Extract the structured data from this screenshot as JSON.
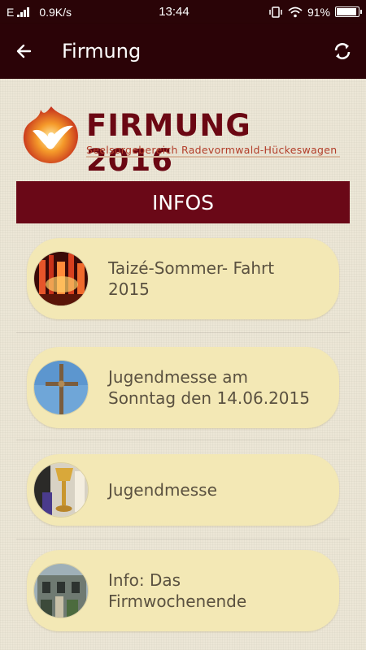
{
  "status_bar": {
    "network": "E",
    "speed": "0.9K/s",
    "time": "13:44",
    "battery_text": "91%",
    "battery_level": 0.91
  },
  "app_bar": {
    "title": "Firmung",
    "back_icon": "arrow-left-icon",
    "refresh_icon": "refresh-icon",
    "background": "#2b0307"
  },
  "logo": {
    "title": "FIRMUNG 2016",
    "subtitle": "Seelsorgebereich Radevormwald-Hückeswagen"
  },
  "section": {
    "title": "INFOS",
    "color": "#6a0817"
  },
  "items": [
    {
      "label": "Taizé-Sommer- Fahrt 2015",
      "thumb": "candles-image"
    },
    {
      "label": "Jugendmesse am Sonntag den 14.06.2015",
      "thumb": "cross-image"
    },
    {
      "label": "Jugendmesse",
      "thumb": "chalice-image"
    },
    {
      "label": "Info: Das Firmwochenende",
      "thumb": "building-image"
    }
  ],
  "card_color": "#f3e8b5"
}
